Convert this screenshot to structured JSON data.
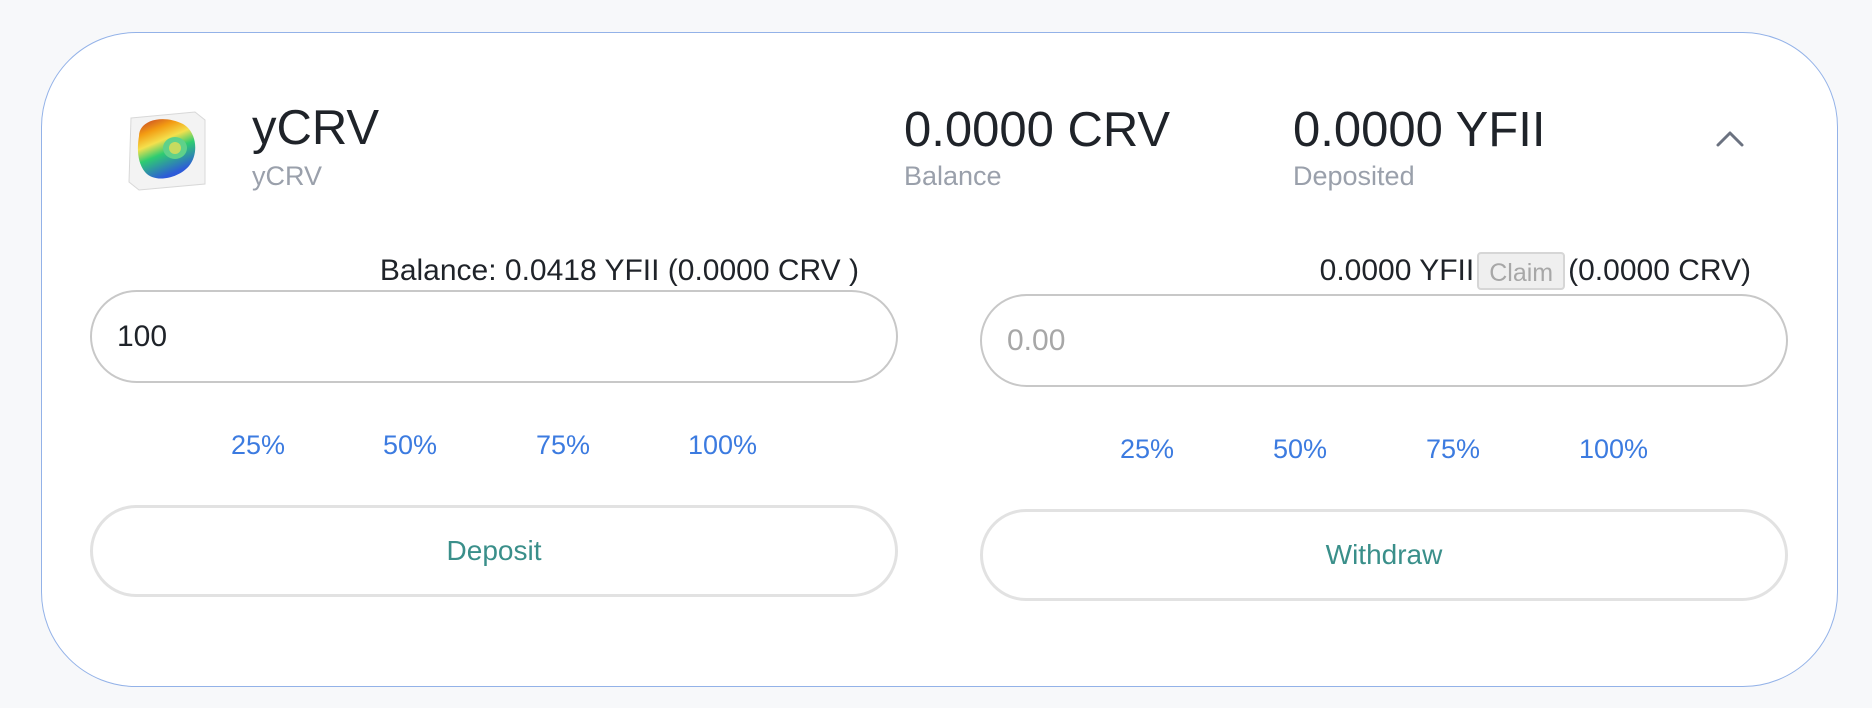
{
  "pool": {
    "name": "yCRV",
    "subtitle": "yCRV",
    "balance_value": "0.0000 CRV",
    "balance_label": "Balance",
    "deposited_value": "0.0000 YFII",
    "deposited_label": "Deposited",
    "icon": "curve-logo",
    "collapse_icon": "chevron-up-icon"
  },
  "deposit": {
    "info": "Balance: 0.0418 YFII (0.0000 CRV )",
    "input_value": "100",
    "percentages": [
      "25%",
      "50%",
      "75%",
      "100%"
    ],
    "button_label": "Deposit"
  },
  "withdraw": {
    "amount": "0.0000 YFII",
    "claim_label": "Claim",
    "crv_amount": "(0.0000 CRV)",
    "input_placeholder": "0.00",
    "percentages": [
      "25%",
      "50%",
      "75%",
      "100%"
    ],
    "button_label": "Withdraw"
  },
  "colors": {
    "link": "#3c7be0",
    "button_text": "#3a8f8a",
    "card_border": "#93b2e8"
  }
}
